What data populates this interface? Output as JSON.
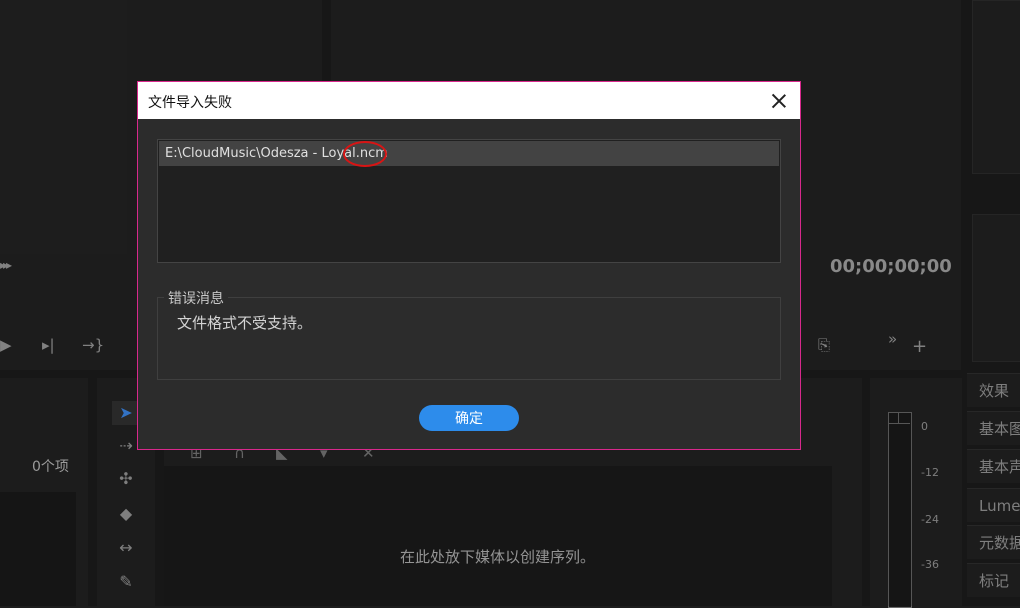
{
  "dialog": {
    "title": "文件导入失败",
    "file_path": "E:\\CloudMusic\\Odesza - Loyal.ncm",
    "error_legend": "错误消息",
    "error_text": "文件格式不受支持。",
    "ok_label": "确定"
  },
  "program_monitor": {
    "timecode": "00;00;00;00"
  },
  "project_panel": {
    "item_count": "0个项"
  },
  "timeline": {
    "drop_hint": "在此处放下媒体以创建序列。"
  },
  "audio_meter": {
    "ticks": [
      "0",
      "-12",
      "-24",
      "-36"
    ]
  },
  "right_tabs": [
    "效果",
    "基本图",
    "基本声",
    "Lumetri",
    "元数据",
    "标记"
  ],
  "colors": {
    "dialog_border": "#d8288c",
    "ok_button": "#2d8ceb",
    "annotation_circle": "#d81414",
    "selected_tool": "#3d8cf0"
  },
  "icons": {
    "tools": [
      "selection-arrow-icon",
      "track-select-icon",
      "ripple-edit-icon",
      "razor-icon",
      "slip-icon",
      "pen-icon"
    ],
    "monitor_controls": [
      "play-icon",
      "step-forward-icon",
      "go-to-out-icon",
      "export-frame-icon",
      "more-icon",
      "add-icon"
    ],
    "timeline_tools": [
      "nest-icon",
      "snap-magnet-icon",
      "linked-selection-icon",
      "marker-icon",
      "wrench-icon"
    ]
  }
}
